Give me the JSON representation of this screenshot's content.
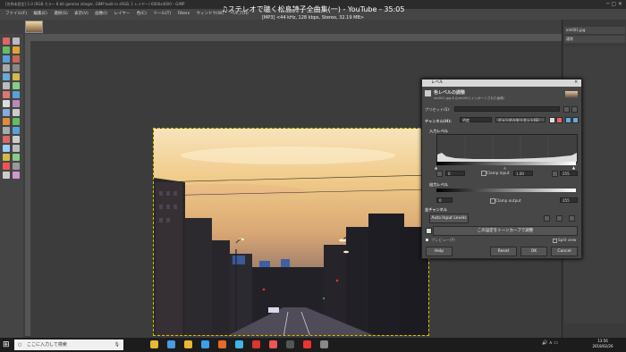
{
  "window": {
    "title": "[名称未設定]-1.0 (RGB カラー 8 bit gamma integer, GIMP built-in sRGB, 1 レイヤー) 6000x4000 – GIMP"
  },
  "video_overlay": {
    "title": "♫ステレオで聴く松島詩子全曲集(一) - YouTube - 35:05",
    "info": "[MP3] <44 kHz, 128 kbps, Stereo, 32.19 MB>"
  },
  "menubar": [
    "ファイル(F)",
    "編集(E)",
    "選択(S)",
    "表示(V)",
    "画像(I)",
    "レイヤー",
    "色(C)",
    "ツール(T)",
    "Filters",
    "ウィンドウ(W)",
    "ヘルプ(H)"
  ],
  "dock": {
    "filename": "xm001.jpg",
    "mode_label": "通常"
  },
  "levels": {
    "window_title": "レベル",
    "header": "色レベルの調整",
    "subheader": "xm001.jpg-6 ([xm001] インポートされた画像)",
    "preset_label": "プリセット(S):",
    "channel_label": "チャンネル(H):",
    "channel_value": "明度",
    "channel_reset": "チャンネルをリセット(E)",
    "input_levels": "入力レベル",
    "input_low": "0",
    "gamma": "1.00",
    "input_high": "255",
    "clamp_input": "Clamp input",
    "output_levels": "出力レベル",
    "output_low": "0",
    "output_high": "255",
    "clamp_output": "Clamp output",
    "all_channels": "全チャンネル",
    "auto_input": "Auto Input Levels",
    "edit_as_curves": "この設定をトーンカーブで調整",
    "preview": "プレビュー(P)",
    "split_view": "Split view",
    "help": "Help",
    "reset": "Reset",
    "ok": "OK",
    "cancel": "Cancel"
  },
  "taskbar": {
    "search_placeholder": "ここに入力して検索",
    "time": "13:56",
    "date": "2018/02/26"
  },
  "colors": {
    "toolbox_icons": [
      "#d66",
      "#bbb",
      "#6b6",
      "#e3a33a",
      "#5aa0d8",
      "#c65",
      "#aaa",
      "#888",
      "#6ad",
      "#d6b84a",
      "#bbb",
      "#8c8",
      "#d77",
      "#5aa0d8",
      "#ddd",
      "#b8b",
      "#8ad",
      "#ccc",
      "#e08b3a",
      "#6b6",
      "#aaa",
      "#5aa0d8",
      "#d66",
      "#ccc",
      "#9cf",
      "#bbb",
      "#d6b84a",
      "#8c8",
      "#e55",
      "#999",
      "#ccc",
      "#c9c"
    ],
    "taskbar_icons": [
      "#e8b931",
      "#4a9be0",
      "#e8b931",
      "#3aa0e8",
      "#e46b2c",
      "#42b3e8",
      "#d33",
      "#e55",
      "#555",
      "#e33",
      "#888"
    ]
  }
}
